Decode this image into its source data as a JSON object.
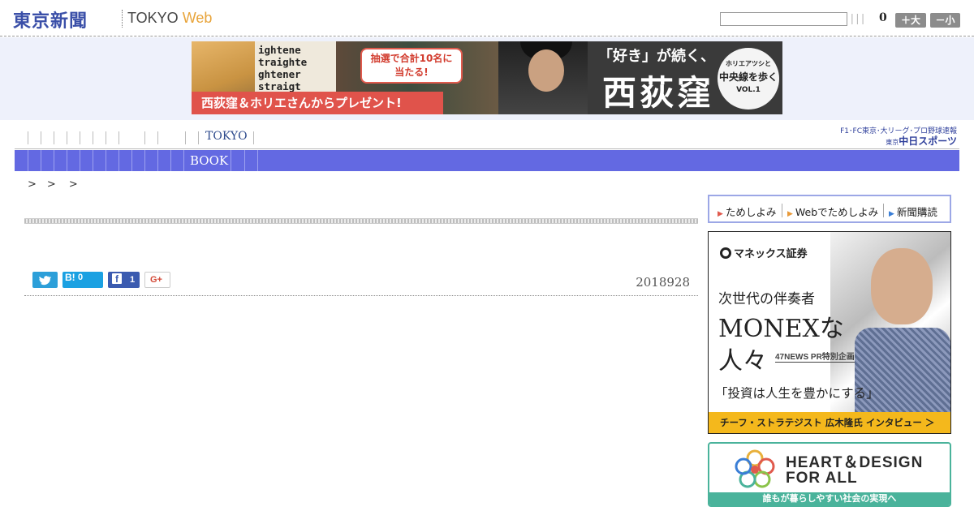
{
  "header": {
    "logo_jp": "東京新聞",
    "logo_en": "TOKYO",
    "logo_web": "Web",
    "search_placeholder": "",
    "pipes": "|||",
    "count": "0",
    "size_up_label": "＋大",
    "size_down_label": "－小"
  },
  "banner": {
    "sign_text": "ightene\ntraighte\nghtener\nstraigt",
    "bubble": "抽選で合計10名に\n当たる!",
    "strip": "西荻窪＆ホリエさんからプレゼント!",
    "quote": "「好き」が続く、",
    "title": "西荻窪",
    "circle_top": "ホリエアツシと",
    "circle_mid": "中央線を歩く",
    "circle_vol": "VOL.1"
  },
  "nav": {
    "tokyo_label": "TOKYO",
    "book_label": "BOOK"
  },
  "chunichi": {
    "top": "F1･FC東京･大リーグ･プロ野球速報",
    "prefix": "東京",
    "name": "中日スポーツ"
  },
  "breadcrumb": ">　> >",
  "article": {
    "date": "2018928"
  },
  "share": {
    "twitter_icon": "twitter-icon",
    "hatena_label": "B!",
    "hatena_count": "0",
    "facebook_label": "f",
    "facebook_count": "1",
    "gplus_label": "G+"
  },
  "sidebar_nav": {
    "items": [
      "ためしよみ",
      "Webでためしよみ",
      "新聞購読"
    ]
  },
  "ad_monex": {
    "logo": "マネックス証券",
    "line1": "次世代の伴奏者",
    "line2": "MONEXな",
    "line3": "人々",
    "tag": "47NEWS PR特別企画",
    "quote": "「投資は人生を豊かにする」",
    "bar": "チーフ・ストラテジスト 広木隆氏 インタビュー ＞"
  },
  "ad_heart": {
    "line1": "HEART＆DESIGN",
    "line2": "FOR ALL",
    "bar": "誰もが暮らしやすい社会の実現へ"
  },
  "colors": {
    "brand_blue": "#3a4fa8",
    "nav_blue": "#6369e2",
    "heart_green": "#4ab39b",
    "monex_yellow": "#f4b81c"
  }
}
